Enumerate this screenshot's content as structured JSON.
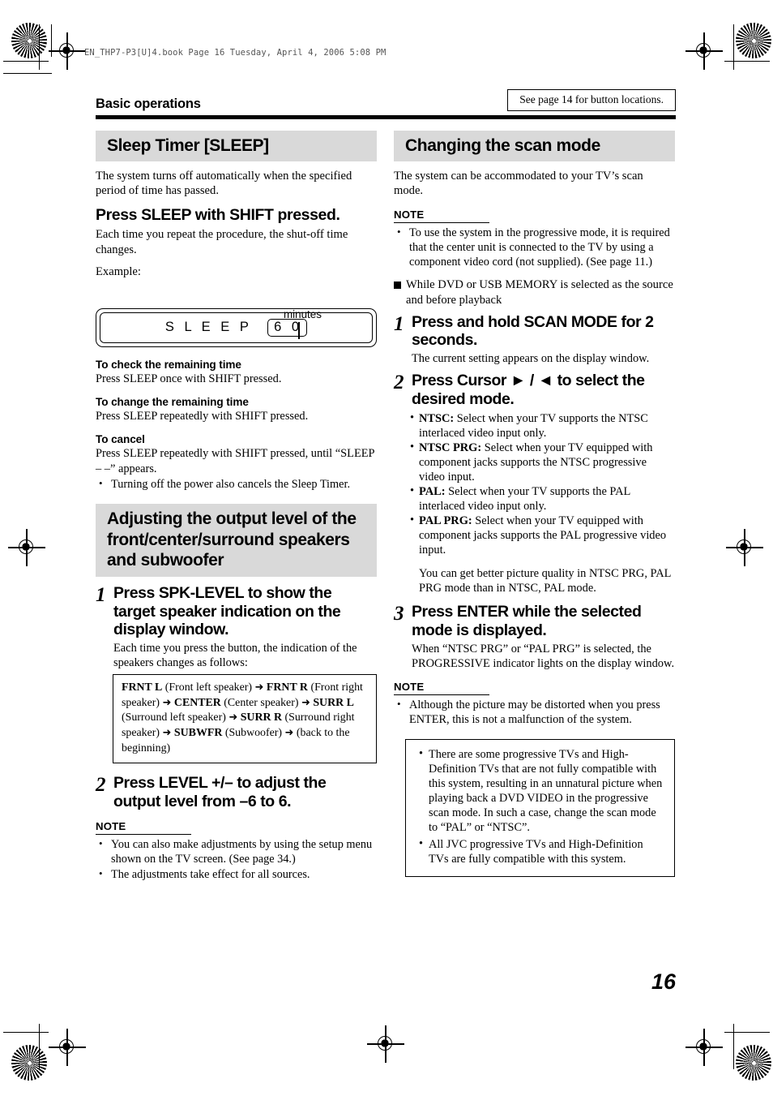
{
  "file_line": "EN_THP7-P3[U]4.book  Page 16  Tuesday, April 4, 2006  5:08 PM",
  "header": {
    "running_head": "Basic operations",
    "location_note": "See page 14 for button locations."
  },
  "page_number": "16",
  "left_column": {
    "section1": {
      "heading": "Sleep Timer [SLEEP]",
      "intro": "The system turns off automatically when the specified period of time has passed.",
      "lead": "Press SLEEP with SHIFT pressed.",
      "lead_desc": "Each time you repeat the procedure, the shut-off time changes.",
      "example_label": "Example:",
      "figure": {
        "caption": "minutes",
        "display_text": "S L E E P",
        "display_value": "6 0"
      },
      "subsections": [
        {
          "title": "To check the remaining time",
          "text": "Press SLEEP once with SHIFT pressed."
        },
        {
          "title": "To change the remaining time",
          "text": "Press SLEEP repeatedly with SHIFT pressed."
        },
        {
          "title": "To cancel",
          "text": "Press SLEEP repeatedly with SHIFT pressed, until “SLEEP – –” appears."
        }
      ],
      "cancel_bullet": "Turning off the power also cancels the Sleep Timer."
    },
    "section2": {
      "heading": "Adjusting the output level of the front/center/surround speakers and subwoofer",
      "steps": [
        {
          "number": "1",
          "title": "Press SPK-LEVEL to show the target speaker indication on the display window.",
          "desc": "Each time you press the button, the indication of the speakers changes as follows:"
        },
        {
          "number": "2",
          "title": "Press LEVEL +/– to adjust the output level from –6 to 6.",
          "desc": ""
        }
      ],
      "sequence_box": {
        "items": [
          {
            "bold": "FRNT L",
            "plain": " (Front left speaker)"
          },
          {
            "bold": "FRNT R",
            "plain": " (Front right speaker)"
          },
          {
            "bold": "CENTER",
            "plain": " (Center speaker)"
          },
          {
            "bold": "SURR L",
            "plain": " (Surround left speaker)"
          },
          {
            "bold": "SURR R",
            "plain": " (Surround right speaker)"
          },
          {
            "bold": "SUBWFR",
            "plain": " (Subwoofer)"
          },
          {
            "bold": "",
            "plain": "(back to the beginning)"
          }
        ],
        "arrow": "➜"
      },
      "note_label": "NOTE",
      "notes": [
        "You can also make adjustments by using the setup menu shown on the TV screen. (See page 34.)",
        "The adjustments take effect for all sources."
      ]
    }
  },
  "right_column": {
    "section": {
      "heading": "Changing the scan mode",
      "intro": "The system can be accommodated to your TV’s scan mode.",
      "note_label_1": "NOTE",
      "note_1": "To use the system in the progressive mode, it is required that the center unit is connected to the TV by using a component video cord (not supplied). (See page 11.)",
      "square_heading": "While DVD or USB MEMORY is selected as the source and before playback",
      "steps": [
        {
          "number": "1",
          "title": "Press and hold SCAN MODE for 2 seconds.",
          "desc": "The current setting appears on the display window."
        },
        {
          "number": "2",
          "title": "Press Cursor ► / ◄ to select the desired mode.",
          "desc": ""
        },
        {
          "number": "3",
          "title": "Press ENTER while the selected mode is displayed.",
          "desc": "When “NTSC PRG” or “PAL PRG” is selected, the PROGRESSIVE indicator lights on the display window."
        }
      ],
      "modes": [
        {
          "name": "NTSC:",
          "text": " Select when your TV supports the NTSC interlaced video input only."
        },
        {
          "name": "NTSC PRG:",
          "text": " Select when your TV equipped with component jacks supports the NTSC progressive video input."
        },
        {
          "name": "PAL:",
          "text": " Select when your TV supports the PAL interlaced video input only."
        },
        {
          "name": "PAL PRG:",
          "text": " Select when your TV equipped with component jacks supports the PAL progressive video input."
        }
      ],
      "quality_note": "You can get better picture quality in NTSC PRG, PAL PRG mode than in NTSC, PAL mode.",
      "note_label_2": "NOTE",
      "note_2": "Although the picture may be distorted when you press ENTER, this is not a malfunction of the system.",
      "warning_box": [
        "There are some progressive TVs and High-Definition TVs that are not fully compatible with this system, resulting in an unnatural picture when playing back a DVD VIDEO in the progressive scan mode. In such a case, change the scan mode to “PAL” or “NTSC”.",
        "All JVC progressive TVs and High-Definition TVs are fully compatible with this system."
      ]
    }
  }
}
